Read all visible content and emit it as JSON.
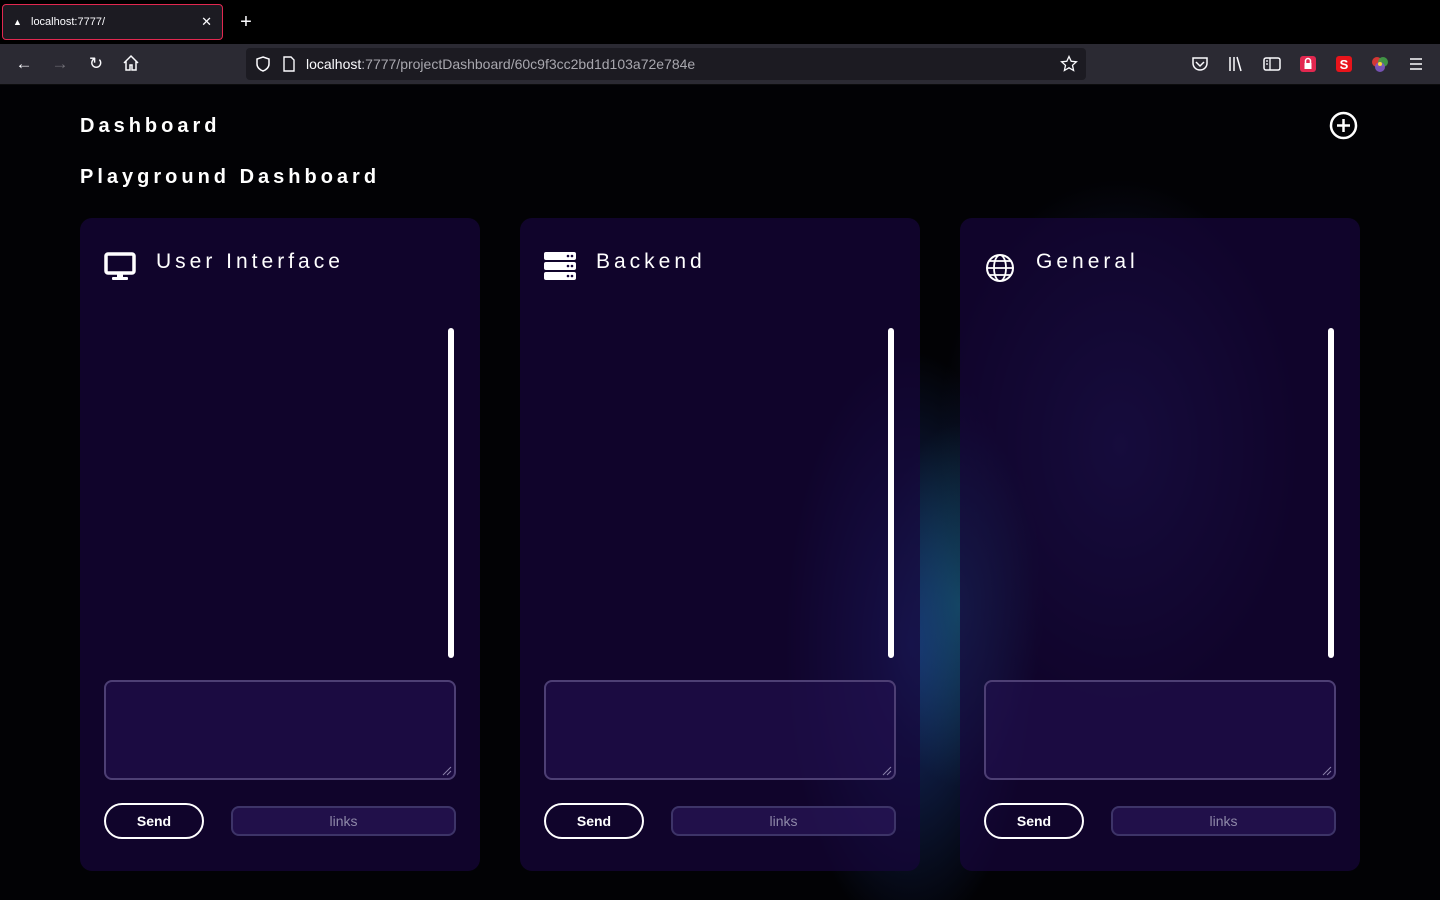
{
  "browser": {
    "tab_title": "localhost:7777/",
    "url_host": "localhost",
    "url_rest": ":7777/projectDashboard/60c9f3cc2bd1d103a72e784e"
  },
  "page": {
    "header": "Dashboard",
    "subheader": "Playground Dashboard"
  },
  "cards": [
    {
      "title": "User Interface",
      "icon": "monitor-icon",
      "send_label": "Send",
      "links_label": "links"
    },
    {
      "title": "Backend",
      "icon": "server-icon",
      "send_label": "Send",
      "links_label": "links"
    },
    {
      "title": "General",
      "icon": "globe-icon",
      "send_label": "Send",
      "links_label": "links"
    }
  ],
  "colors": {
    "accent": "#e22850",
    "card_bg": "#16063a",
    "page_bg": "#020205"
  }
}
